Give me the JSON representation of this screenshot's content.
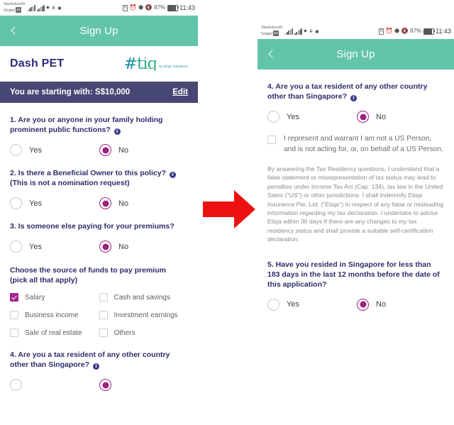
{
  "statusbar": {
    "carrier_line1": "StarHub/unifi",
    "carrier_line2": "Singtel",
    "sim_tag": "4G",
    "nfc_icon": "nfc-icon",
    "alarm_icon": "alarm-icon",
    "bluetooth_icon": "bluetooth-icon",
    "vibrate_icon": "vibrate-icon",
    "battery_percent": "87%",
    "time": "11:43"
  },
  "header": {
    "title": "Sign Up",
    "back_icon": "chevron-left-icon",
    "color": "#62c4a8"
  },
  "brand": {
    "product_name": "Dash PET",
    "logo_mark": "#tiq",
    "logo_tagline": "by Etiqa Insurance"
  },
  "amount_bar": {
    "label": "You are starting with: S$10,000",
    "edit_label": "Edit",
    "color": "#474775"
  },
  "colors": {
    "teal": "#62c4a8",
    "purple_bar": "#474775",
    "magenta": "#9e1f7e",
    "checkbox_on": "#a3248f",
    "question_text": "#2d2d6b",
    "arrow_red": "#ee1111"
  },
  "left_screen": {
    "questions": [
      {
        "text": "1. Are you or anyone in your family holding prominent public functions?",
        "has_info": true,
        "options": [
          {
            "label": "Yes",
            "selected": false
          },
          {
            "label": "No",
            "selected": true
          }
        ]
      },
      {
        "text": "2. Is there a Beneficial Owner to this policy?",
        "has_info": true,
        "subtext": "(This is not a nomination request)",
        "options": [
          {
            "label": "Yes",
            "selected": false
          },
          {
            "label": "No",
            "selected": true
          }
        ]
      },
      {
        "text": "3. Is someone else paying for your premiums?",
        "has_info": false,
        "options": [
          {
            "label": "Yes",
            "selected": false
          },
          {
            "label": "No",
            "selected": true
          }
        ]
      }
    ],
    "funds_heading_line1": "Choose the source of funds to pay premium",
    "funds_heading_line2": "(pick all that apply)",
    "funds_options": [
      {
        "label": "Salary",
        "checked": true
      },
      {
        "label": "Cash and savings",
        "checked": false
      },
      {
        "label": "Business income",
        "checked": false
      },
      {
        "label": "Investment earnings",
        "checked": false
      },
      {
        "label": "Sale of real estate",
        "checked": false
      },
      {
        "label": "Others",
        "checked": false
      }
    ],
    "question4": {
      "text": "4. Are you a tax resident of any other country other than Singapore?",
      "has_info": true
    }
  },
  "right_screen": {
    "question4": {
      "text": "4. Are you a tax resident of any other country other than Singapore?",
      "has_info": true,
      "options": [
        {
          "label": "Yes",
          "selected": false
        },
        {
          "label": "No",
          "selected": true
        }
      ]
    },
    "declaration": {
      "text": "I represent and warrant I am not a US Person, and is not acting for, or, on behalf of a US Person.",
      "checked": false
    },
    "legal_text": "By answering the Tax Residency questions, I understand that a false statement or misrepresentation of tax status may lead to penalties under Income Tax Act (Cap. 134), tax law in the United Sates (\"US\") or other jurisdictions. I shall indemnify Etiqa Insurance Pte. Ltd. (\"Etiqa\") in respect of any false or misleading information regarding my tax declaration. I undertake to advise Etiqa within 30 days if there are any changes to my tax residency status and shall provide a suitable self-certification declaration.",
    "question5": {
      "text": "5. Have you resided in Singapore for less than 183 days in the last 12 months before the date of this application?",
      "has_info": false,
      "options": [
        {
          "label": "Yes",
          "selected": false
        },
        {
          "label": "No",
          "selected": true
        }
      ]
    }
  },
  "arrow": {
    "icon": "right-arrow-icon",
    "color": "#ee1111"
  }
}
